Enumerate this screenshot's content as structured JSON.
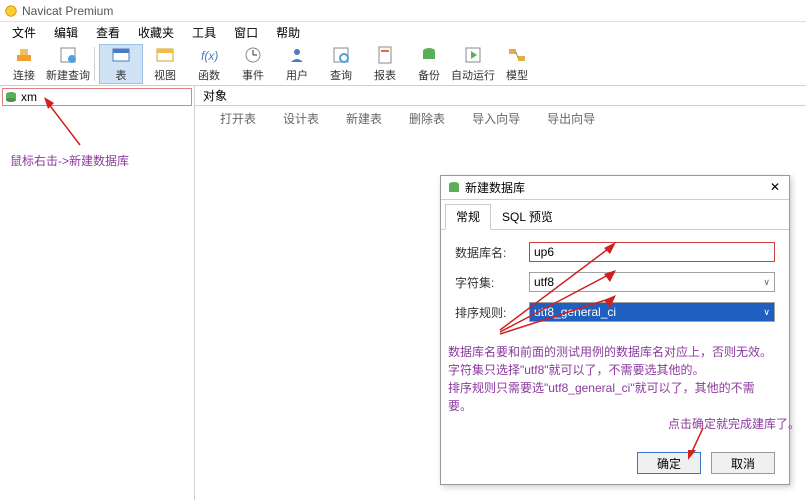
{
  "app": {
    "title": "Navicat Premium"
  },
  "menu": {
    "file": "文件",
    "edit": "编辑",
    "view": "查看",
    "favorites": "收藏夹",
    "tools": "工具",
    "window": "窗口",
    "help": "帮助"
  },
  "tools": {
    "connect": "连接",
    "newquery": "新建查询",
    "table": "表",
    "view": "视图",
    "function": "函数",
    "event": "事件",
    "user": "用户",
    "query": "查询",
    "report": "报表",
    "backup": "备份",
    "autorun": "自动运行",
    "model": "模型"
  },
  "sidebar": {
    "conn": "xm"
  },
  "tab": {
    "objects": "对象"
  },
  "subtools": {
    "open": "打开表",
    "design": "设计表",
    "new": "新建表",
    "delete": "删除表",
    "import": "导入向导",
    "export": "导出向导"
  },
  "dialog": {
    "title": "新建数据库",
    "tabs": {
      "general": "常规",
      "sql": "SQL 预览"
    },
    "labels": {
      "dbname": "数据库名:",
      "charset": "字符集:",
      "collation": "排序规则:"
    },
    "values": {
      "dbname": "up6",
      "charset": "utf8",
      "collation": "utf8_general_ci"
    },
    "ok": "确定",
    "cancel": "取消"
  },
  "annotations": {
    "rightclick": "鼠标右击->新建数据库",
    "warn": "数据库名要和前面的测试用例的数据库名对应上，否则无效。\n字符集只选择\"utf8\"就可以了，不需要选其他的。\n排序规则只需要选\"utf8_general_ci\"就可以了，其他的不需要。",
    "confirm": "点击确定就完成建库了。"
  }
}
